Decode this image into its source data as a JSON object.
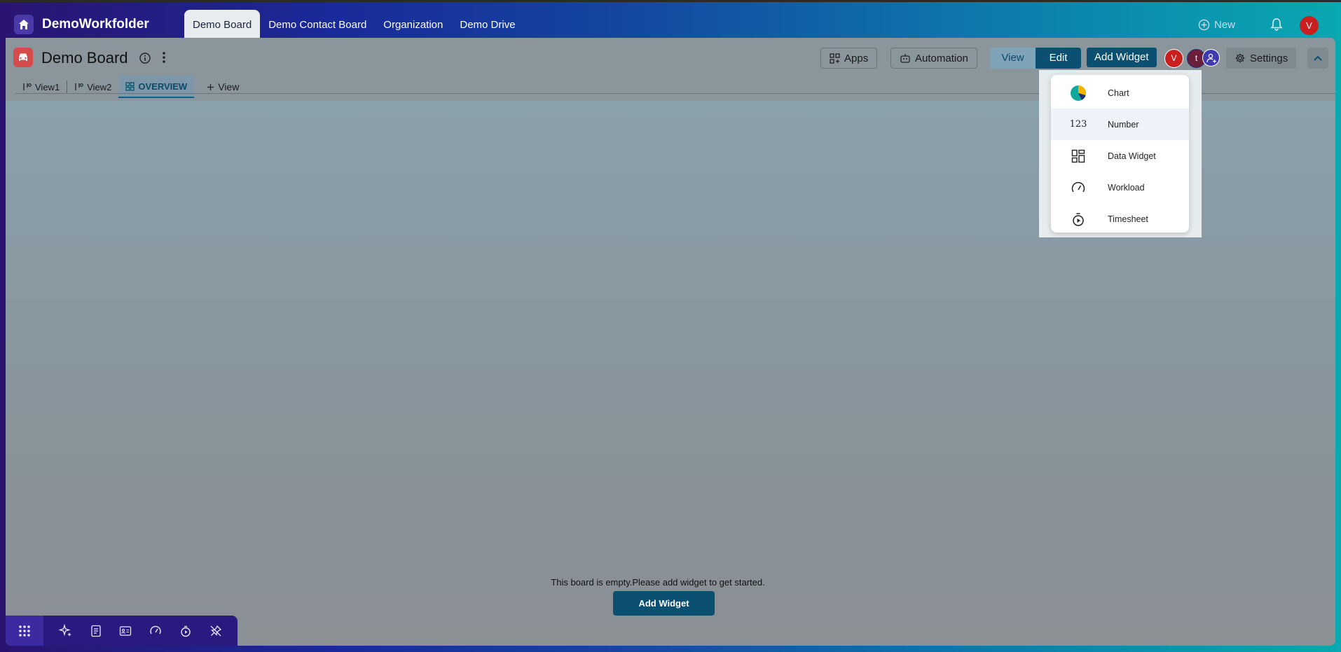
{
  "app": {
    "name": "DemoWorkfolder",
    "new_label": "New",
    "user_initial": "V"
  },
  "nav_tabs": [
    {
      "label": "Demo Board",
      "active": true
    },
    {
      "label": "Demo Contact Board",
      "active": false
    },
    {
      "label": "Organization",
      "active": false
    },
    {
      "label": "Demo Drive",
      "active": false
    }
  ],
  "board": {
    "title": "Demo Board",
    "apps_label": "Apps",
    "automation_label": "Automation",
    "view_label": "View",
    "edit_label": "Edit",
    "add_widget_label": "Add Widget",
    "settings_label": "Settings",
    "members": [
      {
        "initial": "V",
        "color": "#c9201f"
      },
      {
        "initial": "t",
        "color": "#6b1f3a"
      }
    ]
  },
  "view_tabs": [
    {
      "label": "View1",
      "active": false
    },
    {
      "label": "View2",
      "active": false
    },
    {
      "label": "OVERVIEW",
      "active": true
    }
  ],
  "add_view_label": "View",
  "empty_state": {
    "message": "This board is empty.Please add widget to get started.",
    "button_label": "Add Widget"
  },
  "widget_menu": [
    {
      "label": "Chart",
      "icon": "pie-chart-icon"
    },
    {
      "label": "Number",
      "icon": "number-icon",
      "icon_text": "123"
    },
    {
      "label": "Data Widget",
      "icon": "grid-widget-icon"
    },
    {
      "label": "Workload",
      "icon": "gauge-icon"
    },
    {
      "label": "Timesheet",
      "icon": "stopwatch-icon"
    }
  ],
  "colors": {
    "primary": "#0b4f71",
    "accent_red": "#c9201f"
  }
}
